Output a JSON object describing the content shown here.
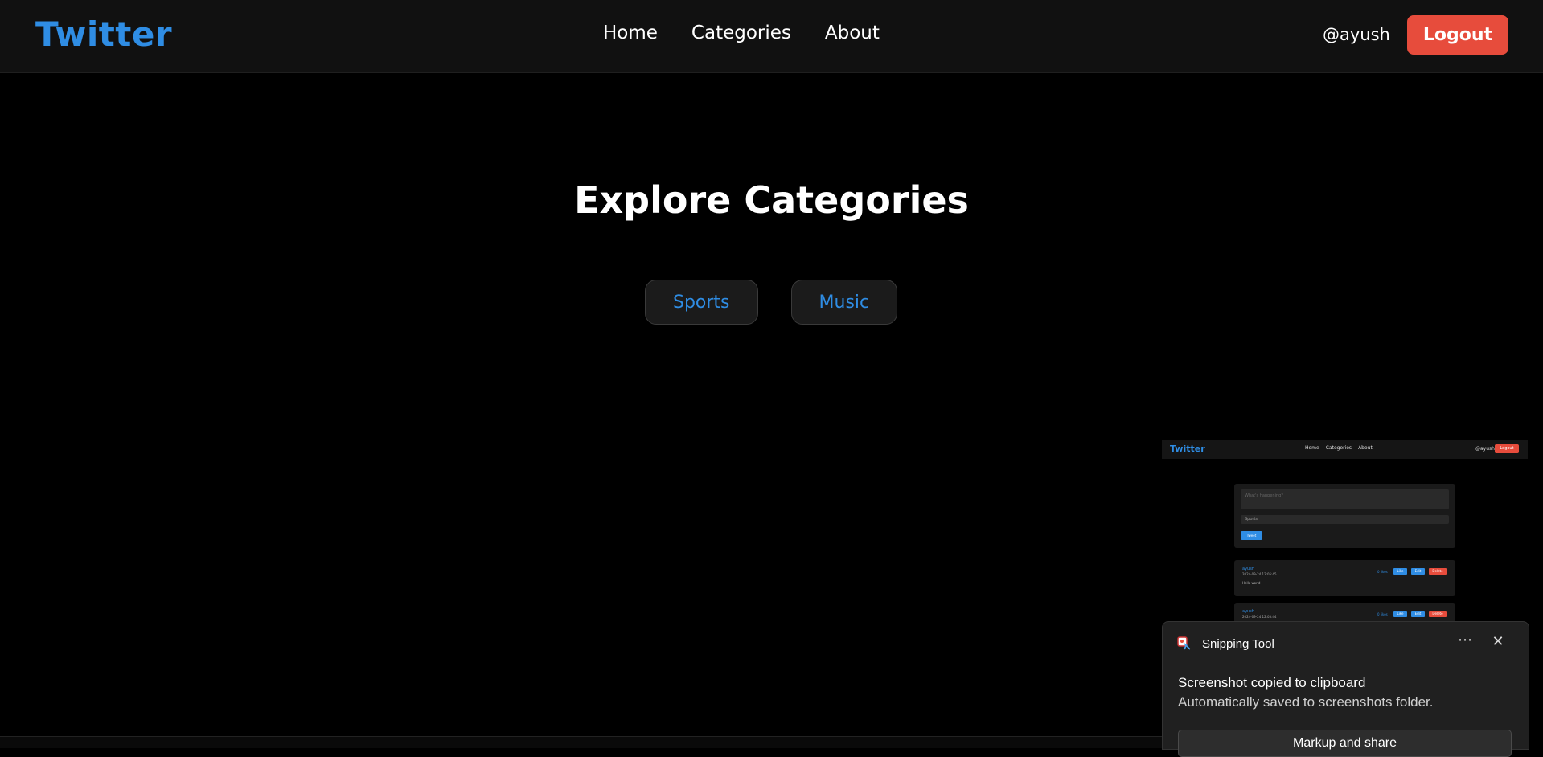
{
  "navbar": {
    "brand": "Twitter",
    "links": [
      "Home",
      "Categories",
      "About"
    ],
    "username": "@ayush",
    "logout_label": "Logout"
  },
  "main": {
    "title": "Explore Categories",
    "categories": [
      "Sports",
      "Music"
    ]
  },
  "snip_preview": {
    "brand": "Twitter",
    "links": [
      "Home",
      "Categories",
      "About"
    ],
    "username": "@ayush",
    "logout_label": "Logout",
    "input_placeholder": "What's happening?",
    "select_value": "Sports",
    "post_button": "Tweet",
    "posts": [
      {
        "author": "ayush",
        "time": "2024-09-24 12:05:45",
        "text": "Hello world",
        "likes": "0 likes",
        "like": "Like",
        "edit": "Edit",
        "delete": "Delete"
      },
      {
        "author": "ayush",
        "time": "2024-09-24 12:03:44",
        "text": "",
        "likes": "0 likes",
        "like": "Like",
        "edit": "Edit",
        "delete": "Delete"
      }
    ]
  },
  "toast": {
    "app_name": "Snipping Tool",
    "more_icon": "ellipsis-icon",
    "close_icon": "close-icon",
    "title": "Screenshot copied to clipboard",
    "body": "Automatically saved to screenshots folder.",
    "action_label": "Markup and share"
  },
  "colors": {
    "accent": "#2f8de4",
    "danger": "#e74c3c",
    "background": "#000000",
    "navbar": "#111111"
  }
}
